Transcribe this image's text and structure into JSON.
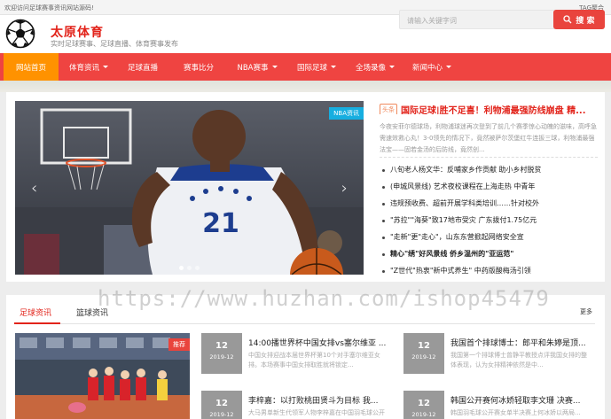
{
  "topbar": {
    "welcome": "欢迎访问足球赛事资讯网站源码!",
    "tag": "TAG聚合"
  },
  "header": {
    "site_name": "太原体育",
    "tagline": "实时足球赛事、足球直播、体育赛事发布"
  },
  "search": {
    "placeholder": "请输入关键字词",
    "button_label": "搜 索"
  },
  "nav": {
    "items": [
      {
        "label": "网站首页",
        "active": true,
        "dropdown": false
      },
      {
        "label": "体育资讯",
        "active": false,
        "dropdown": true
      },
      {
        "label": "足球直播",
        "active": false,
        "dropdown": false
      },
      {
        "label": "赛事比分",
        "active": false,
        "dropdown": false
      },
      {
        "label": "NBA赛事",
        "active": false,
        "dropdown": true
      },
      {
        "label": "国际足球",
        "active": false,
        "dropdown": true
      },
      {
        "label": "全场录像",
        "active": false,
        "dropdown": true
      },
      {
        "label": "新闻中心",
        "active": false,
        "dropdown": true
      }
    ]
  },
  "slider": {
    "badge": "NBA资讯",
    "jersey_number": "21",
    "prev_icon": "chevron-left-icon",
    "next_icon": "chevron-right-icon"
  },
  "headline": {
    "tag": "头条",
    "title": "国际足球|胜不足喜！利物浦最强防线崩盘 精...",
    "summary": "今夜安菲尔德球场，利物浦球迷再次登到了前几个赛季惊心动魄的滋味，高呼急需速效救心丸！3-0领先的情况下，竟然被萨尔茨堡红牛连扳三球，利物浦最强法宝——固若金汤的后防线，竟然创..."
  },
  "news_list": [
    {
      "text": "八旬老人杨文华：反哺家乡作贡献 助小乡村脱贫",
      "bold": false
    },
    {
      "text": "(申城风景线) 艺术夜校课程在上海走热 中青年",
      "bold": false
    },
    {
      "text": "违规预收费、超前开展学科类培训……针对校外",
      "bold": false
    },
    {
      "text": "\"苏拉\"\"海葵\"致17地市受灾 广东拨付1.75亿元",
      "bold": false
    },
    {
      "text": "\"走新\"更\"走心\"，山东东营掀起网络安全宣",
      "bold": false
    },
    {
      "text": "精心\"绣\"好风景线 侨乡温州的\"亚运范\"",
      "bold": true
    },
    {
      "text": "\"Z世代\"热衷\"新中式养生\" 中药版酸梅汤引领",
      "bold": false
    }
  ],
  "tabs": {
    "items": [
      "足球资讯",
      "篮球资讯"
    ],
    "more": "更多"
  },
  "feature_photo": {
    "badge": "推荐"
  },
  "cards": [
    {
      "day": "12",
      "ym": "2019-12",
      "title": "14:00播世界杯中国女排vs塞尔维亚 ...",
      "desc": "中国女排迎战本届世界杯第10个对手塞尔维亚女排。本场赛事中国女排取胜就将锁定..."
    },
    {
      "day": "12",
      "ym": "2019-12",
      "title": "我国首个排球博士：郎平和朱婷是顶...",
      "desc": "我国第一个排球博士曾静平教授点评我国女排的整体表现，认为女排精神依然是中..."
    },
    {
      "day": "12",
      "ym": "2019-12",
      "title": "李梓嘉：以打败桃田贤斗为目标 我...",
      "desc": "大马男单新生代领军人物李梓嘉在中国羽毛球公开赛..."
    },
    {
      "day": "12",
      "ym": "2019-12",
      "title": "韩国公开赛何冰娇轻取李文珊 决赛...",
      "desc": "韩国羽毛球公开赛女单半决赛上何冰娇以两局..."
    }
  ],
  "watermark": "https://www.huzhan.com/ishop45479",
  "colors": {
    "brand_red": "#ef4441",
    "active_orange": "#ff9200",
    "badge_blue": "#17aee0"
  }
}
